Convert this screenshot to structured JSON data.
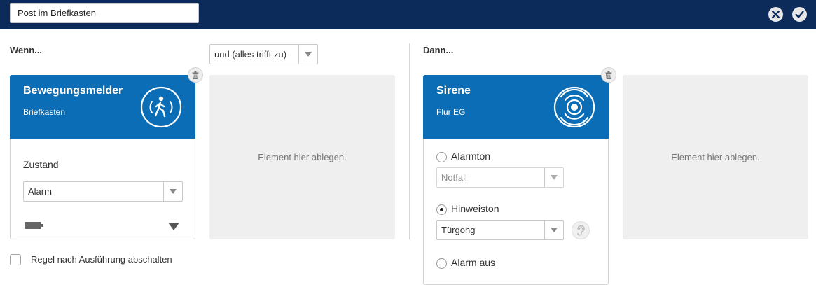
{
  "header": {
    "rule_name": "Post im Briefkasten",
    "close_icon": "close-icon",
    "confirm_icon": "checkmark-icon"
  },
  "if_section": {
    "title": "Wenn...",
    "logic_select": "und (alles trifft zu)",
    "card": {
      "title": "Bewegungsmelder",
      "subtitle": "Briefkasten",
      "icon": "motion-person-icon",
      "state_label": "Zustand",
      "state_value": "Alarm",
      "battery_icon": "battery-icon"
    },
    "drop_zone": "Element hier ablegen.",
    "disable_after_label": "Regel nach Ausführung abschalten"
  },
  "then_section": {
    "title": "Dann...",
    "card": {
      "title": "Sirene",
      "subtitle": "Flur EG",
      "icon": "siren-icon",
      "options": [
        {
          "label": "Alarmton",
          "select": "Notfall",
          "checked": false,
          "disabled": true
        },
        {
          "label": "Hinweiston",
          "select": "Türgong",
          "checked": true,
          "disabled": false
        },
        {
          "label": "Alarm aus",
          "checked": false
        }
      ]
    },
    "drop_zone": "Element hier ablegen."
  },
  "colors": {
    "header_bg": "#0d2b5a",
    "card_header": "#0b6db6",
    "drop_zone": "#efefef"
  }
}
